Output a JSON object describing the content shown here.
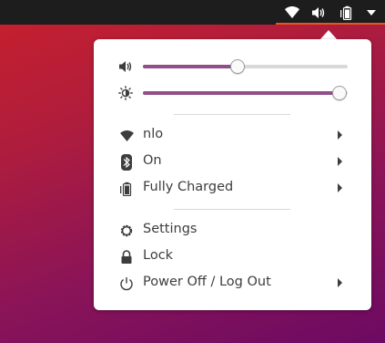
{
  "topbar": {
    "status_icons": [
      "wifi-icon",
      "volume-icon",
      "battery-icon",
      "menu-caret-icon"
    ]
  },
  "sliders": {
    "volume": {
      "icon": "volume-icon",
      "level": 0.46
    },
    "brightness": {
      "icon": "brightness-icon",
      "level": 0.96
    }
  },
  "menu": {
    "network": {
      "icon": "wifi-icon",
      "label": "nlo"
    },
    "bluetooth": {
      "icon": "bluetooth-icon",
      "label": "On"
    },
    "battery": {
      "icon": "battery-icon",
      "label": "Fully Charged"
    },
    "settings": {
      "icon": "gear-icon",
      "label": "Settings"
    },
    "lock": {
      "icon": "lock-icon",
      "label": "Lock"
    },
    "power": {
      "icon": "power-icon",
      "label": "Power Off / Log Out"
    }
  },
  "colors": {
    "accent": "#924d8b",
    "topbar_underline": "#e95420",
    "topbar_bg": "#1d1d1d"
  }
}
